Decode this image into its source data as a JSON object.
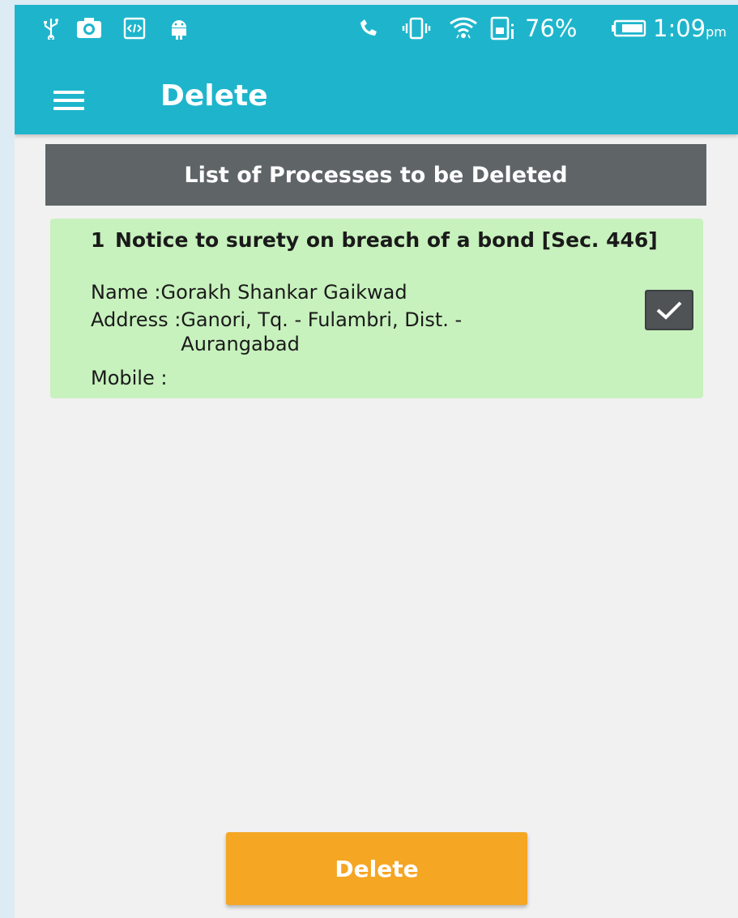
{
  "status_bar": {
    "battery_percent": "76%",
    "time": "1:09",
    "time_suffix": "pm",
    "icons": [
      "usb-icon",
      "camera-icon",
      "code-icon",
      "android-icon",
      "missed-call-icon",
      "vibrate-icon",
      "wifi-icon",
      "sim-icon",
      "battery-icon"
    ]
  },
  "app_bar": {
    "title": "Delete",
    "menu_icon": "hamburger-menu-icon"
  },
  "list": {
    "header": "List of Processes to be Deleted",
    "items": [
      {
        "number": "1",
        "title": "Notice to surety on breach of a bond [Sec. 446]",
        "name_label": "Name : ",
        "name": "Gorakh Shankar Gaikwad",
        "address_label": "Address : ",
        "address": "Ganori, Tq. - Fulambri, Dist. - Aurangabad",
        "mobile_label": "Mobile : ",
        "mobile": "",
        "checked": true
      }
    ]
  },
  "actions": {
    "delete_label": "Delete"
  },
  "colors": {
    "primary": "#1eb5cc",
    "header_bg": "#5f6467",
    "card_bg": "#c7f1bd",
    "button_bg": "#f5a623"
  }
}
